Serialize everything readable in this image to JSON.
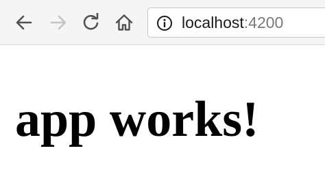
{
  "browser": {
    "toolbar": {
      "back_icon": "arrow-left",
      "forward_icon": "arrow-right",
      "reload_icon": "reload",
      "home_icon": "home",
      "site_info_icon": "info-circle"
    },
    "address_bar": {
      "host": "localhost",
      "port": ":4200"
    }
  },
  "page": {
    "heading": "app works!"
  },
  "colors": {
    "toolbar_bg": "#f5f5f5",
    "icon_active": "#505050",
    "icon_disabled": "#c4c4c4",
    "url_host": "#1a1a1a",
    "url_port": "#7a7a7a",
    "heading": "#000000"
  }
}
